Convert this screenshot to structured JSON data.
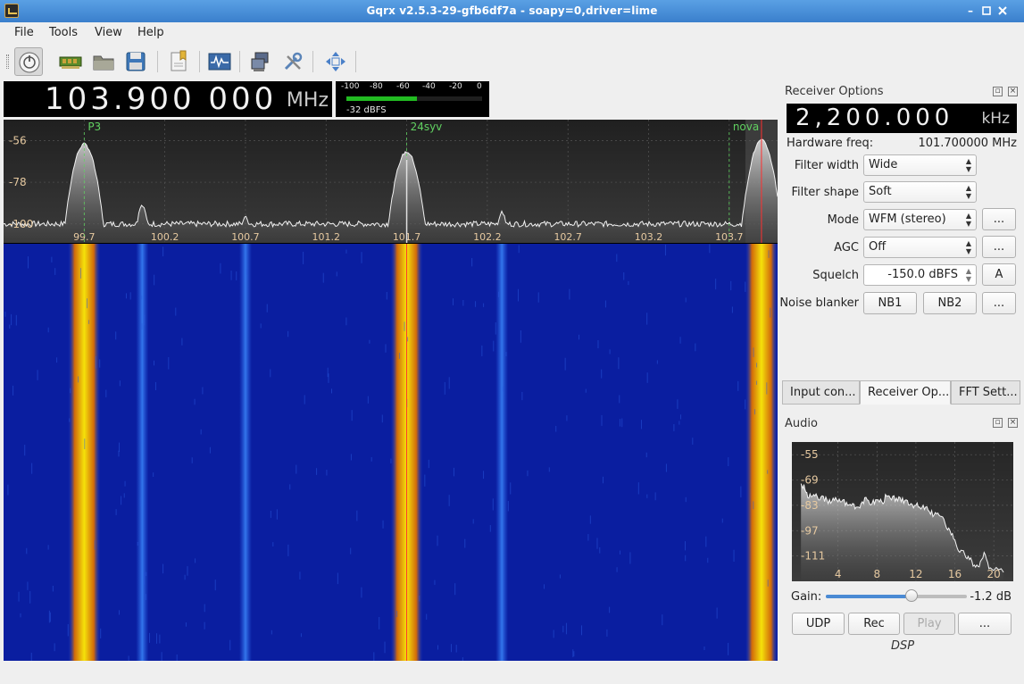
{
  "window": {
    "title": "Gqrx v2.5.3-29-gfb6df7a - soapy=0,driver=lime"
  },
  "menu": [
    "File",
    "Tools",
    "View",
    "Help"
  ],
  "toolbar": [
    "power-icon",
    "hardware-icon",
    "open-icon",
    "save-icon",
    "bookmark-icon",
    "signal-icon",
    "network-icon",
    "tools-icon",
    "fullscreen-icon"
  ],
  "frequency": {
    "digits": "103.900 000",
    "unit": "MHz"
  },
  "smeter": {
    "ticks": [
      "-100",
      "-80",
      "-60",
      "-40",
      "-20",
      "0"
    ],
    "readout": "-32 dBFS",
    "level_fraction": 0.52
  },
  "plotter": {
    "ylabels": [
      "-56",
      "-78",
      "-100"
    ],
    "xlabels": [
      "99.7",
      "100.2",
      "100.7",
      "101.2",
      "101.7",
      "102.2",
      "102.7",
      "103.2",
      "103.7"
    ],
    "bookmarks": [
      {
        "name": "P3",
        "freq": 99.7
      },
      {
        "name": "24syv",
        "freq": 101.7
      },
      {
        "name": "nova",
        "freq": 103.7
      }
    ],
    "freq_range": [
      99.2,
      104.0
    ],
    "level_range": [
      -110,
      -45
    ],
    "peaks": [
      {
        "freq": 99.7,
        "level": -58
      },
      {
        "freq": 100.06,
        "level": -90
      },
      {
        "freq": 100.7,
        "level": -96
      },
      {
        "freq": 101.7,
        "level": -62
      },
      {
        "freq": 102.29,
        "level": -94
      },
      {
        "freq": 103.9,
        "level": -56
      }
    ],
    "noise_floor": -100,
    "hardware_marker": 101.7,
    "demod_marker": 103.9,
    "colors": {
      "bg": "#000000",
      "waterfall": "#0a1ea0",
      "signal_hot": "#f5e20a",
      "signal_warm": "#d26a0a",
      "marker": "#ff3030",
      "bookmark": "#60d060"
    }
  },
  "receiver": {
    "panel_title": "Receiver Options",
    "lcd": {
      "digits": "2,200.000",
      "unit": "kHz"
    },
    "hw_freq_label": "Hardware freq:",
    "hw_freq_value": "101.700000 MHz",
    "filter_width_label": "Filter width",
    "filter_width_value": "Wide",
    "filter_shape_label": "Filter shape",
    "filter_shape_value": "Soft",
    "mode_label": "Mode",
    "mode_value": "WFM (stereo)",
    "agc_label": "AGC",
    "agc_value": "Off",
    "squelch_label": "Squelch",
    "squelch_value": "-150.0 dBFS",
    "squelch_auto": "A",
    "noise_blanker_label": "Noise blanker",
    "nb1": "NB1",
    "nb2": "NB2",
    "more": "...",
    "tabs": [
      "Input con...",
      "Receiver Op...",
      "FFT Sett..."
    ]
  },
  "audio": {
    "panel_title": "Audio",
    "ylabels": [
      "-55",
      "-69",
      "-83",
      "-97",
      "-111"
    ],
    "xlabels": [
      "4",
      "8",
      "12",
      "16",
      "20"
    ],
    "spectrum": [
      [
        0.2,
        -71
      ],
      [
        0.6,
        -74
      ],
      [
        1.0,
        -79
      ],
      [
        1.5,
        -77
      ],
      [
        2.0,
        -80
      ],
      [
        2.5,
        -78
      ],
      [
        3.0,
        -82
      ],
      [
        3.5,
        -79
      ],
      [
        4.0,
        -81
      ],
      [
        4.5,
        -80
      ],
      [
        5.0,
        -83
      ],
      [
        5.5,
        -82
      ],
      [
        6.0,
        -84
      ],
      [
        6.5,
        -81
      ],
      [
        7.0,
        -80
      ],
      [
        7.5,
        -82
      ],
      [
        8.0,
        -80
      ],
      [
        8.5,
        -81
      ],
      [
        9.0,
        -78
      ],
      [
        9.5,
        -80
      ],
      [
        10.0,
        -79
      ],
      [
        10.5,
        -81
      ],
      [
        11.0,
        -80
      ],
      [
        11.5,
        -82
      ],
      [
        12.0,
        -83
      ],
      [
        12.5,
        -85
      ],
      [
        13.0,
        -84
      ],
      [
        13.5,
        -88
      ],
      [
        14.0,
        -87
      ],
      [
        14.5,
        -89
      ],
      [
        15.0,
        -93
      ],
      [
        15.5,
        -97
      ],
      [
        16.0,
        -102
      ],
      [
        16.5,
        -109
      ],
      [
        17.0,
        -110
      ],
      [
        17.5,
        -113
      ],
      [
        18.0,
        -116
      ],
      [
        18.5,
        -117
      ],
      [
        19.0,
        -109
      ],
      [
        19.5,
        -118
      ],
      [
        20.0,
        -119
      ],
      [
        21.0,
        -120
      ]
    ],
    "gain_label": "Gain:",
    "gain_value": "-1.2 dB",
    "gain_fraction": 0.61,
    "udp": "UDP",
    "rec": "Rec",
    "play": "Play",
    "more": "...",
    "footer": "DSP"
  }
}
